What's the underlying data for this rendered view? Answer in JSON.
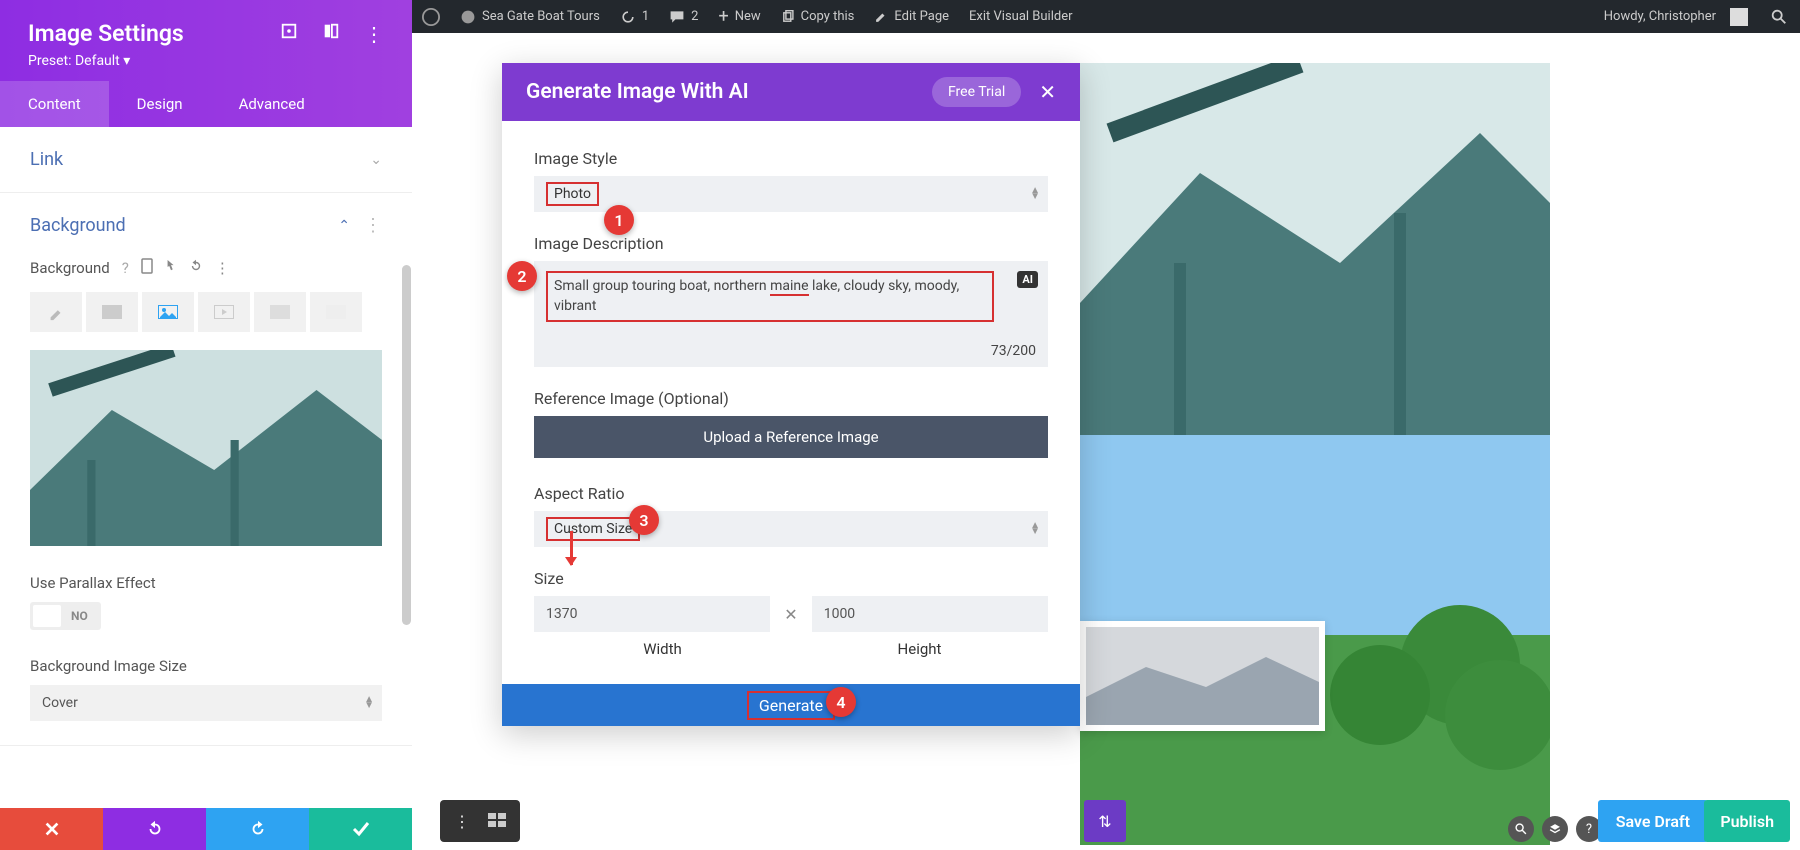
{
  "wp_bar": {
    "site_name": "Sea Gate Boat Tours",
    "refresh_count": "1",
    "comments_count": "2",
    "new": "New",
    "copy": "Copy this",
    "edit": "Edit Page",
    "exit": "Exit Visual Builder",
    "howdy": "Howdy, Christopher"
  },
  "sidebar": {
    "title": "Image Settings",
    "preset": "Preset: Default ▾",
    "tabs": {
      "content": "Content",
      "design": "Design",
      "advanced": "Advanced"
    },
    "sections": {
      "link": "Link",
      "background": "Background"
    },
    "bg_label": "Background",
    "parallax_label": "Use Parallax Effect",
    "parallax_value": "NO",
    "bgsize_label": "Background Image Size",
    "bgsize_value": "Cover"
  },
  "modal": {
    "title": "Generate Image With AI",
    "trial": "Free Trial",
    "labels": {
      "style": "Image Style",
      "desc": "Image Description",
      "ref": "Reference Image (Optional)",
      "aspect": "Aspect Ratio",
      "size": "Size"
    },
    "style_value": "Photo",
    "desc_value_pre": "Small group touring boat, northern ",
    "desc_value_und": "maine",
    "desc_value_post": " lake, cloudy sky, moody, vibrant",
    "char_count": "73/200",
    "ai_chip": "AI",
    "upload": "Upload a Reference Image",
    "aspect_value": "Custom Size",
    "width_value": "1370",
    "height_value": "1000",
    "width_label": "Width",
    "height_label": "Height",
    "generate": "Generate"
  },
  "callouts": {
    "c1": "1",
    "c2": "2",
    "c3": "3",
    "c4": "4"
  },
  "bottom": {
    "save_draft": "Save Draft",
    "publish": "Publish"
  }
}
